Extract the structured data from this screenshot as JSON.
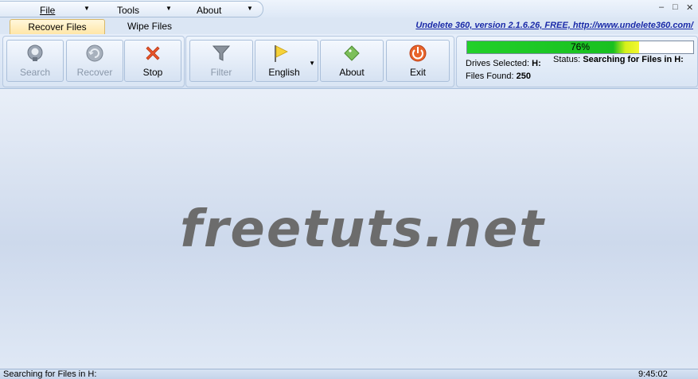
{
  "menu": {
    "items": [
      {
        "label": "File"
      },
      {
        "label": "Tools"
      },
      {
        "label": "About"
      }
    ]
  },
  "window_controls": {
    "minimize": "–",
    "maximize": "□",
    "close": "✕"
  },
  "tabs": [
    {
      "label": "Recover Files",
      "active": true
    },
    {
      "label": "Wipe Files",
      "active": false
    }
  ],
  "version_text": "Undelete 360, version 2.1.6.26, FREE, http://www.undelete360.com/",
  "ribbon": {
    "group1": [
      {
        "label": "Search",
        "icon": "search-icon",
        "enabled": false
      },
      {
        "label": "Recover",
        "icon": "recover-icon",
        "enabled": false
      },
      {
        "label": "Stop",
        "icon": "stop-icon",
        "enabled": true
      }
    ],
    "group2": [
      {
        "label": "Filter",
        "icon": "filter-icon",
        "enabled": false
      },
      {
        "label": "English",
        "icon": "flag-icon",
        "enabled": true
      },
      {
        "label": "About",
        "icon": "about-icon",
        "enabled": true
      },
      {
        "label": "Exit",
        "icon": "exit-icon",
        "enabled": true
      }
    ]
  },
  "progress": {
    "percent_label": "76%",
    "value": 0.76
  },
  "info": {
    "drives_label": "Drives Selected:",
    "drives_value": "H:",
    "status_label": "Status:",
    "status_value": "Searching for Files in H:",
    "found_label": "Files Found:",
    "found_value": "250"
  },
  "watermark": "freetuts.net",
  "statusbar": {
    "text": "Searching for Files in H:",
    "time": "9:45:02"
  },
  "colors": {
    "accent": "#1a2aa8",
    "progress_green": "#19c020",
    "progress_yellow": "#f4f830"
  }
}
